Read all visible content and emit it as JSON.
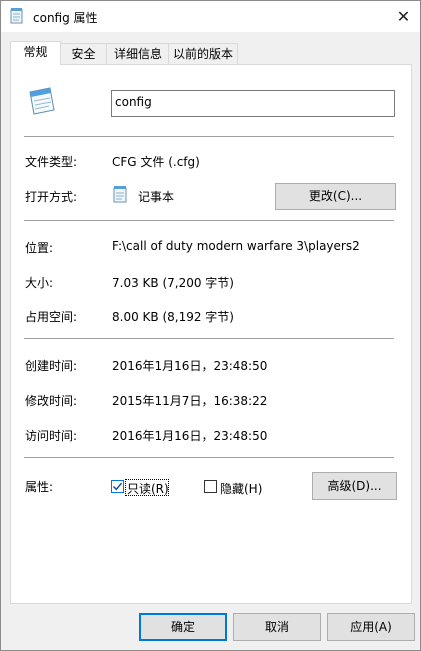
{
  "window": {
    "title": "config 属性"
  },
  "tabs": [
    "常规",
    "安全",
    "详细信息",
    "以前的版本"
  ],
  "file": {
    "name": "config",
    "type_label": "文件类型:",
    "type_value": "CFG 文件 (.cfg)",
    "opens_label": "打开方式:",
    "opens_value": "记事本",
    "change_btn": "更改(C)...",
    "location_label": "位置:",
    "location_value": "F:\\call of duty modern warfare 3\\players2",
    "size_label": "大小:",
    "size_value": "7.03 KB (7,200 字节)",
    "disk_label": "占用空间:",
    "disk_value": "8.00 KB (8,192 字节)",
    "created_label": "创建时间:",
    "created_value": "2016年1月16日，23:48:50",
    "modified_label": "修改时间:",
    "modified_value": "2015年11月7日，16:38:22",
    "accessed_label": "访问时间:",
    "accessed_value": "2016年1月16日，23:48:50",
    "attr_label": "属性:",
    "readonly_label": "只读(R)",
    "readonly_checked": true,
    "hidden_label": "隐藏(H)",
    "hidden_checked": false,
    "advanced_btn": "高级(D)..."
  },
  "footer": {
    "ok": "确定",
    "cancel": "取消",
    "apply": "应用(A)"
  },
  "colors": {
    "accent": "#0078d7",
    "separator": "#a0a0a0",
    "panel": "#ffffff",
    "chrome": "#f0f0f0"
  }
}
